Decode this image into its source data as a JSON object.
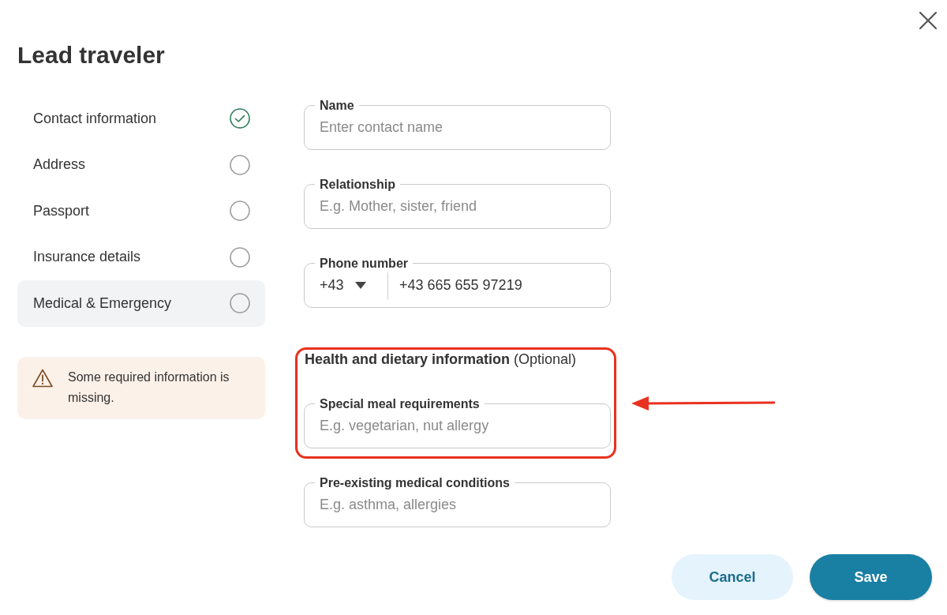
{
  "dialog": {
    "title": "Lead traveler"
  },
  "sidebar": {
    "items": [
      {
        "label": "Contact information",
        "selected": false,
        "completed": true
      },
      {
        "label": "Address",
        "selected": false,
        "completed": false
      },
      {
        "label": "Passport",
        "selected": false,
        "completed": false
      },
      {
        "label": "Insurance details",
        "selected": false,
        "completed": false
      },
      {
        "label": "Medical & Emergency",
        "selected": true,
        "completed": false
      }
    ]
  },
  "alert": {
    "text": "Some required information is missing."
  },
  "form": {
    "groups": [
      {
        "highlighted": false,
        "fields": [
          {
            "kind": "text",
            "label": "Name",
            "placeholder": "Enter contact name"
          },
          {
            "kind": "text",
            "label": "Relationship",
            "placeholder": "E.g. Mother, sister, friend"
          },
          {
            "kind": "phone",
            "label": "Phone number",
            "country_code": "+43",
            "value": "+43 665 655 97219"
          }
        ]
      },
      {
        "heading": "**Health and dietary information** (Optional)",
        "highlighted": true,
        "fields": [
          {
            "kind": "text",
            "label": "Special meal requirements",
            "placeholder": "E.g. vegetarian, nut allergy"
          }
        ]
      },
      {
        "highlighted": false,
        "fields": [
          {
            "kind": "text",
            "label": "Pre-existing medical conditions",
            "placeholder": "E.g. asthma, allergies"
          }
        ]
      }
    ]
  },
  "buttons": [
    {
      "label": "Cancel",
      "kind": "secondary"
    },
    {
      "label": "Save",
      "kind": "primary"
    }
  ]
}
